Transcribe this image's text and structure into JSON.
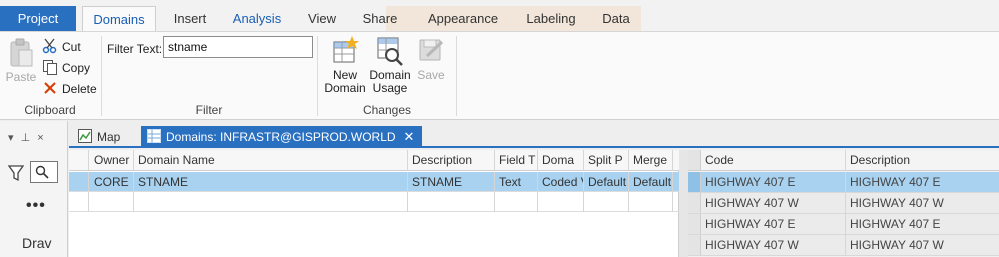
{
  "ribbon": {
    "tabs": [
      {
        "label": "Project"
      },
      {
        "label": "Domains"
      },
      {
        "label": "Insert"
      },
      {
        "label": "Analysis"
      },
      {
        "label": "View"
      },
      {
        "label": "Share"
      },
      {
        "label": "Appearance"
      },
      {
        "label": "Labeling"
      },
      {
        "label": "Data"
      }
    ],
    "clipboard": {
      "paste": "Paste",
      "cut": "Cut",
      "copy": "Copy",
      "delete": "Delete",
      "group_label": "Clipboard"
    },
    "filter": {
      "label": "Filter Text:",
      "value": "stname",
      "group_label": "Filter"
    },
    "changes": {
      "new_domain": "New\nDomain",
      "new_domain_l1": "New",
      "new_domain_l2": "Domain",
      "domain_usage_l1": "Domain",
      "domain_usage_l2": "Usage",
      "save": "Save",
      "group_label": "Changes"
    }
  },
  "left_pane": {
    "controls": "▾ ⊥ ×",
    "more": "•••",
    "title": "Drav"
  },
  "doc_tabs": {
    "map": "Map",
    "domains": "Domains: INFRASTR@GISPROD.WORLD",
    "close": "✕"
  },
  "domain_grid": {
    "columns": [
      "Owner",
      "Domain Name",
      "Description",
      "Field T",
      "Doma",
      "Split P",
      "Merge"
    ],
    "rows": [
      [
        "CORE",
        "STNAME",
        "STNAME",
        "Text",
        "Coded V",
        "Default",
        "Default"
      ],
      [
        "",
        "",
        "",
        "",
        "",
        "",
        ""
      ]
    ]
  },
  "code_table": {
    "columns": [
      "Code",
      "Description"
    ],
    "rows": [
      [
        "HIGHWAY 407  E",
        "HIGHWAY 407  E"
      ],
      [
        "HIGHWAY 407  W",
        "HIGHWAY 407  W"
      ],
      [
        "HIGHWAY 407 E",
        "HIGHWAY 407 E"
      ],
      [
        "HIGHWAY 407 W",
        "HIGHWAY 407 W"
      ]
    ]
  },
  "colors": {
    "accent": "#2a70c1",
    "selection": "#a8d2ef",
    "contextual_tab": "#f1e6d9"
  }
}
